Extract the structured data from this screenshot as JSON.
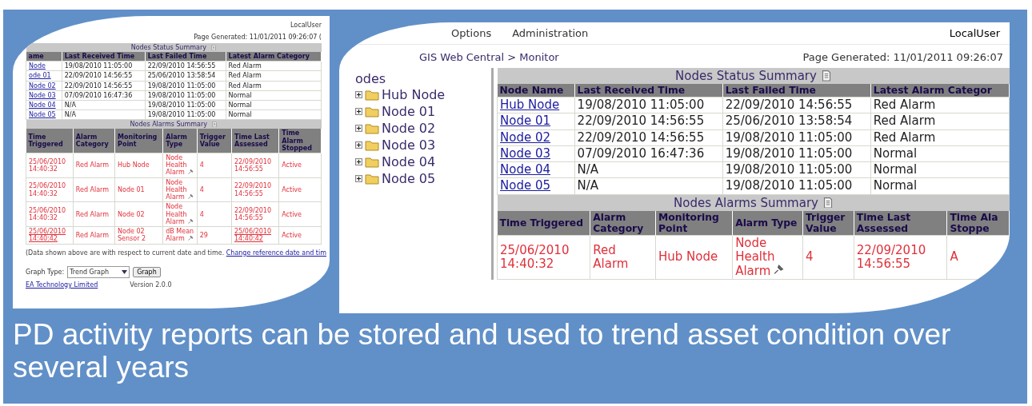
{
  "left_panel": {
    "user": "LocalUser",
    "page_generated": "Page Generated: 11/01/2011 09:26:07 (",
    "status_summary": {
      "title": "Nodes Status Summary",
      "columns": [
        "ame",
        "Last Received Time",
        "Last Failed Time",
        "Latest Alarm Category"
      ],
      "rows": [
        [
          "Node",
          "19/08/2010 11:05:00",
          "22/09/2010 14:56:55",
          "Red Alarm"
        ],
        [
          "ode 01",
          "22/09/2010 14:56:55",
          "25/06/2010 13:58:54",
          "Red Alarm"
        ],
        [
          "Node 02",
          "22/09/2010 14:56:55",
          "19/08/2010 11:05:00",
          "Red Alarm"
        ],
        [
          "Node 03",
          "07/09/2010 16:47:36",
          "19/08/2010 11:05:00",
          "Normal"
        ],
        [
          "Node 04",
          "N/A",
          "19/08/2010 11:05:00",
          "Normal"
        ],
        [
          "Node 05",
          "N/A",
          "19/08/2010 11:05:00",
          "Normal"
        ]
      ]
    },
    "alarms_summary": {
      "title": "Nodes Alarms Summary",
      "columns": [
        "Time Triggered",
        "Alarm Category",
        "Monitoring Point",
        "Alarm Type",
        "Trigger Value",
        "Time Last Assessed",
        "Time Alarm Stopped"
      ],
      "rows": [
        {
          "linked": false,
          "cells": [
            "25/06/2010 14:40:32",
            "Red Alarm",
            "Hub Node",
            "Node Health Alarm",
            "4",
            "22/09/2010 14:56:55",
            "Active"
          ]
        },
        {
          "linked": false,
          "cells": [
            "25/06/2010 14:40:32",
            "Red Alarm",
            "Node 01",
            "Node Health Alarm",
            "4",
            "22/09/2010 14:56:55",
            "Active"
          ]
        },
        {
          "linked": false,
          "cells": [
            "25/06/2010 14:40:32",
            "Red Alarm",
            "Node 02",
            "Node Health Alarm",
            "4",
            "22/09/2010 14:56:55",
            "Active"
          ]
        },
        {
          "linked": true,
          "cells": [
            "25/06/2010 14:40:42",
            "Red Alarm",
            "Node 02 Sensor 2",
            "dB Mean Alarm",
            "29",
            "25/06/2010 14:40:42",
            "Active"
          ]
        }
      ]
    },
    "note": "(Data shown above are with respect to current date and time.",
    "note_link": "Change reference date and tim",
    "graph_label": "Graph Type:",
    "graph_value": "Trend Graph",
    "graph_button": "Graph",
    "footer_link": "EA Technology Limited",
    "version": "Version 2.0.0"
  },
  "right_panel": {
    "menu": [
      "Options",
      "Administration"
    ],
    "user": "LocalUser",
    "breadcrumb": "GIS Web Central > Monitor",
    "page_generated": "Page Generated: 11/01/2011 09:26:07",
    "tree": {
      "title": "odes",
      "items": [
        {
          "label": "Hub Node",
          "expanded": false
        },
        {
          "label": "Node 01",
          "expanded": false
        },
        {
          "label": "Node 02",
          "expanded": false
        },
        {
          "label": "Node 03",
          "expanded": false
        },
        {
          "label": "Node 04",
          "expanded": false
        },
        {
          "label": "Node 05",
          "expanded": false
        }
      ]
    },
    "status_summary": {
      "title": "Nodes Status Summary",
      "columns": [
        "Node Name",
        "Last Received Time",
        "Last Failed Time",
        "Latest Alarm Categor"
      ],
      "rows": [
        [
          "Hub Node",
          "19/08/2010 11:05:00",
          "22/09/2010 14:56:55",
          "Red Alarm"
        ],
        [
          "Node 01",
          "22/09/2010 14:56:55",
          "25/06/2010 13:58:54",
          "Red Alarm"
        ],
        [
          "Node 02",
          "22/09/2010 14:56:55",
          "19/08/2010 11:05:00",
          "Red Alarm"
        ],
        [
          "Node 03",
          "07/09/2010 16:47:36",
          "19/08/2010 11:05:00",
          "Normal"
        ],
        [
          "Node 04",
          "N/A",
          "19/08/2010 11:05:00",
          "Normal"
        ],
        [
          "Node 05",
          "N/A",
          "19/08/2010 11:05:00",
          "Normal"
        ]
      ]
    },
    "alarms_summary": {
      "title": "Nodes Alarms Summary",
      "columns": [
        "Time Triggered",
        "Alarm Category",
        "Monitoring Point",
        "Alarm Type",
        "Trigger Value",
        "Time Last Assessed",
        "Time Ala Stoppe"
      ],
      "rows": [
        {
          "linked": false,
          "cells": [
            "25/06/2010 14:40:32",
            "Red Alarm",
            "Hub Node",
            "Node Health Alarm",
            "4",
            "22/09/2010 14:56:55",
            "A"
          ]
        }
      ]
    }
  },
  "caption": "PD activity reports can be stored and used to trend asset condition over several years"
}
